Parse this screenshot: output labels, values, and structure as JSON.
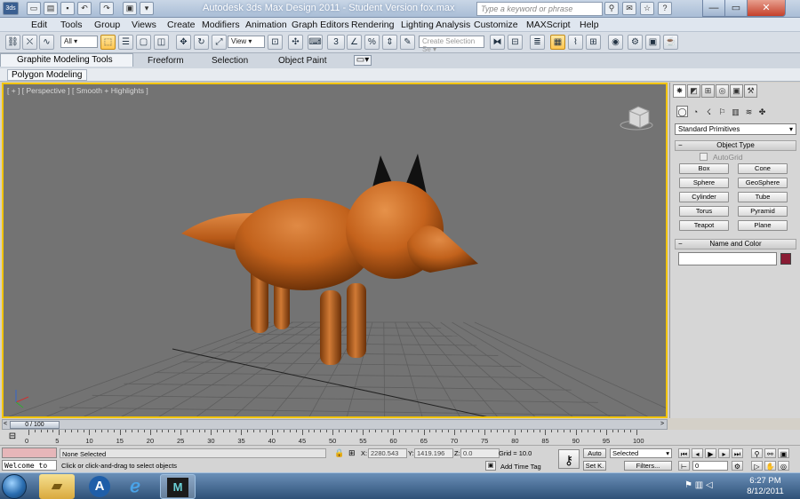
{
  "window": {
    "title": "Autodesk 3ds Max Design 2011  -  Student Version   fox.max",
    "search_placeholder": "Type a keyword or phrase",
    "min_icon": "minimize-icon",
    "max_icon": "maximize-icon",
    "close_icon": "close-icon"
  },
  "menu": [
    "Edit",
    "Tools",
    "Group",
    "Views",
    "Create",
    "Modifiers",
    "Animation",
    "Graph Editors",
    "Rendering",
    "Lighting Analysis",
    "Customize",
    "MAXScript",
    "Help"
  ],
  "toolbar": {
    "selection_filter": "All",
    "ref_coord": "View",
    "named_selection": "Create Selection Se",
    "snap_value": "3"
  },
  "ribbon": {
    "tabs": [
      "Graphite Modeling Tools",
      "Freeform",
      "Selection",
      "Object Paint"
    ],
    "panel": "Polygon Modeling"
  },
  "viewport": {
    "label": "[ + ] [ Perspective ] [ Smooth + Highlights ]",
    "object_color": "#c2621c"
  },
  "command_panel": {
    "category": "Standard Primitives",
    "object_type_title": "Object Type",
    "autogrid": "AutoGrid",
    "primitives": [
      "Box",
      "Cone",
      "Sphere",
      "GeoSphere",
      "Cylinder",
      "Tube",
      "Torus",
      "Pyramid",
      "Teapot",
      "Plane"
    ],
    "name_color_title": "Name and Color",
    "name_value": "",
    "object_color": "#8a1c34"
  },
  "timeline": {
    "position": "0 / 100",
    "ticks": [
      0,
      5,
      10,
      15,
      20,
      25,
      30,
      35,
      40,
      45,
      50,
      55,
      60,
      65,
      70,
      75,
      80,
      85,
      90,
      95,
      100
    ]
  },
  "status": {
    "welcome": "Welcome to",
    "selection": "None Selected",
    "prompt": "Click or click-and-drag to select objects",
    "x_label": "X:",
    "x": "2280.543",
    "y_label": "Y:",
    "y": "1419.196",
    "z_label": "Z:",
    "z": "0.0",
    "grid": "Grid = 10.0",
    "add_time_tag": "Add Time Tag",
    "auto_key": "Auto",
    "set_key": "Set K.",
    "key_filter": "Selected",
    "filters": "Filters...",
    "frame": "0"
  },
  "taskbar": {
    "time": "6:27 PM",
    "date": "8/12/2011",
    "apps": [
      "folder-icon",
      "autodesk-icon",
      "internet-explorer-icon",
      "3dsmax-icon"
    ]
  }
}
